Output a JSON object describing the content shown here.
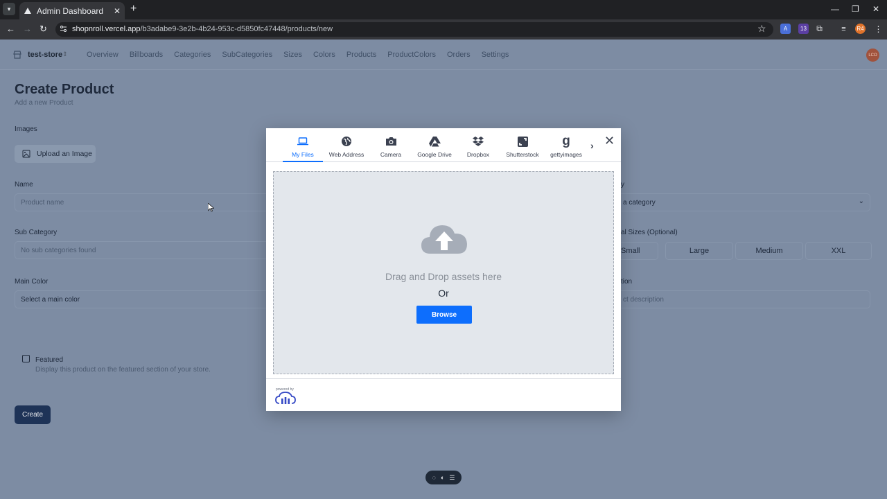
{
  "browser": {
    "tab_title": "Admin Dashboard",
    "tab_close": "✕",
    "new_tab": "+",
    "url_host": "shopnroll.vercel.app",
    "url_path": "/b3adabe9-3e2b-4b24-953c-d5850fc47448/products/new",
    "window_controls": {
      "minimize": "—",
      "restore": "❐",
      "close": "✕"
    },
    "extension_badge": "13",
    "profile_initials": "R4"
  },
  "appnav": {
    "store_name": "test-store",
    "links": [
      "Overview",
      "Billboards",
      "Categories",
      "SubCategories",
      "Sizes",
      "Colors",
      "Products",
      "ProductColors",
      "Orders",
      "Settings"
    ],
    "avatar_text": "LCO"
  },
  "page": {
    "title": "Create Product",
    "subtitle": "Add a new Product",
    "images_label": "Images",
    "upload_label": "Upload an Image",
    "name_label": "Name",
    "name_placeholder": "Product name",
    "subcategory_label": "Sub Category",
    "subcategory_value": "No sub categories found",
    "main_color_label": "Main Color",
    "main_color_value": "Select a main color",
    "category_label_partial": "y",
    "category_value_partial": "a category",
    "sizes_label_partial": "al Sizes (Optional)",
    "sizes": [
      "Small",
      "Large",
      "Medium",
      "XXL"
    ],
    "description_label_partial": "tion",
    "description_placeholder_partial": "ct description",
    "featured_label": "Featured",
    "featured_help": "Display this product on the featured section of your store.",
    "create_label": "Create"
  },
  "modal": {
    "tabs": [
      {
        "label": "My Files",
        "icon": "laptop-icon",
        "active": true
      },
      {
        "label": "Web Address",
        "icon": "globe-icon",
        "active": false
      },
      {
        "label": "Camera",
        "icon": "camera-icon",
        "active": false
      },
      {
        "label": "Google Drive",
        "icon": "google-drive-icon",
        "active": false
      },
      {
        "label": "Dropbox",
        "icon": "dropbox-icon",
        "active": false
      },
      {
        "label": "Shutterstock",
        "icon": "shutterstock-icon",
        "active": false
      },
      {
        "label": "gettyimages",
        "icon": "gettyimages-icon",
        "active": false
      }
    ],
    "drop_text": "Drag and Drop assets here",
    "or_text": "Or",
    "browse_label": "Browse",
    "powered_by": "powered by"
  },
  "colors": {
    "accent": "#0d6efd",
    "overlay_bg": "#7d8ca3",
    "create_button": "#1e3357"
  }
}
